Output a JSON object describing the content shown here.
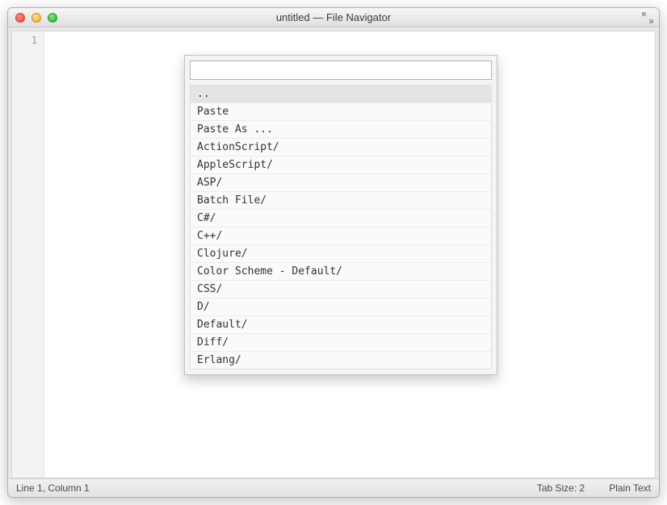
{
  "window": {
    "title": "untitled — File Navigator"
  },
  "gutter": {
    "line1": "1"
  },
  "palette": {
    "input_value": "",
    "items": [
      "..",
      "Paste",
      "Paste As ...",
      "ActionScript/",
      "AppleScript/",
      "ASP/",
      "Batch File/",
      "C#/",
      "C++/",
      "Clojure/",
      "Color Scheme - Default/",
      "CSS/",
      "D/",
      "Default/",
      "Diff/",
      "Erlang/"
    ],
    "selected_index": 0
  },
  "status": {
    "position": "Line 1, Column 1",
    "tab_size": "Tab Size: 2",
    "syntax": "Plain Text"
  }
}
